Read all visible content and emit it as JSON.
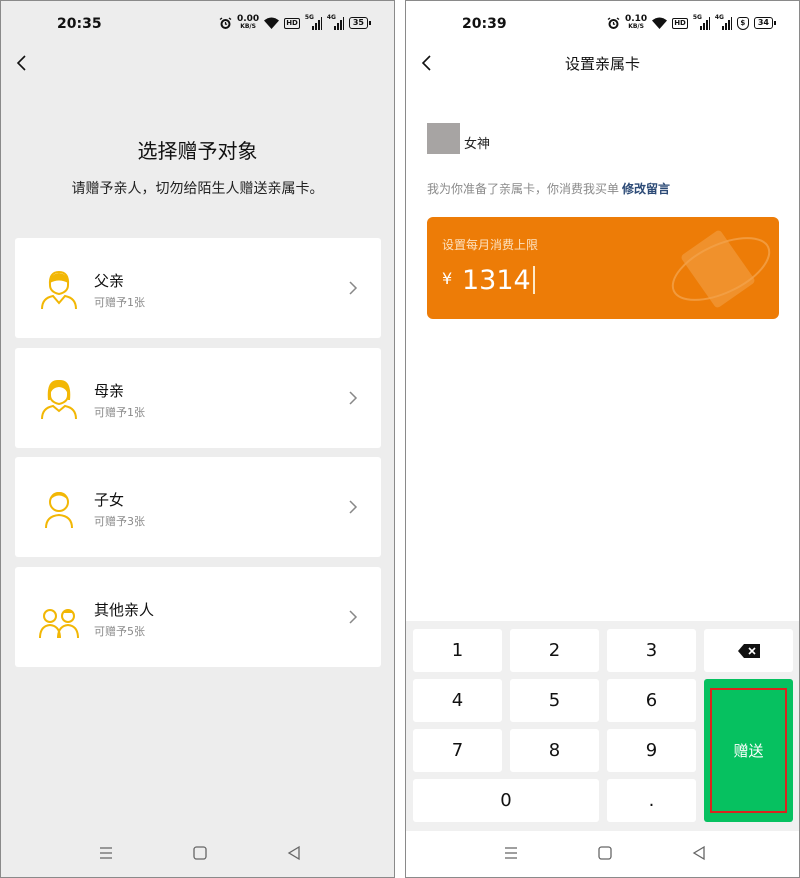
{
  "left": {
    "status": {
      "time": "20:35",
      "speed": "0.00",
      "speed_unit": "KB/S",
      "hd": "HD",
      "net1": "5G",
      "net2": "4G",
      "battery": "35"
    },
    "title": "选择赠予对象",
    "subtitle": "请赠予亲人，切勿给陌生人赠送亲属卡。",
    "options": [
      {
        "label": "父亲",
        "sub": "可赠予1张",
        "icon": "father-icon"
      },
      {
        "label": "母亲",
        "sub": "可赠予1张",
        "icon": "mother-icon"
      },
      {
        "label": "子女",
        "sub": "可赠予3张",
        "icon": "child-icon"
      },
      {
        "label": "其他亲人",
        "sub": "可赠予5张",
        "icon": "relatives-icon"
      }
    ]
  },
  "right": {
    "status": {
      "time": "20:39",
      "speed": "0.10",
      "speed_unit": "KB/S",
      "hd": "HD",
      "net1": "5G",
      "net2": "4G",
      "shield": "$",
      "battery": "34"
    },
    "title": "设置亲属卡",
    "recipient": "女神",
    "message": "我为你准备了亲属卡，你消费我买单",
    "edit_message": "修改留言",
    "card": {
      "label": "设置每月消费上限",
      "currency": "¥",
      "amount": "1314"
    },
    "keys": {
      "k1": "1",
      "k2": "2",
      "k3": "3",
      "k4": "4",
      "k5": "5",
      "k6": "6",
      "k7": "7",
      "k8": "8",
      "k9": "9",
      "k0": "0",
      "dot": "."
    },
    "gift_button": "赠送"
  },
  "colors": {
    "accent_yellow": "#f2b705",
    "orange_card": "#ed7c07",
    "wechat_green": "#06c160",
    "highlight_red": "#d9251e",
    "link_blue": "#2c4a76"
  }
}
